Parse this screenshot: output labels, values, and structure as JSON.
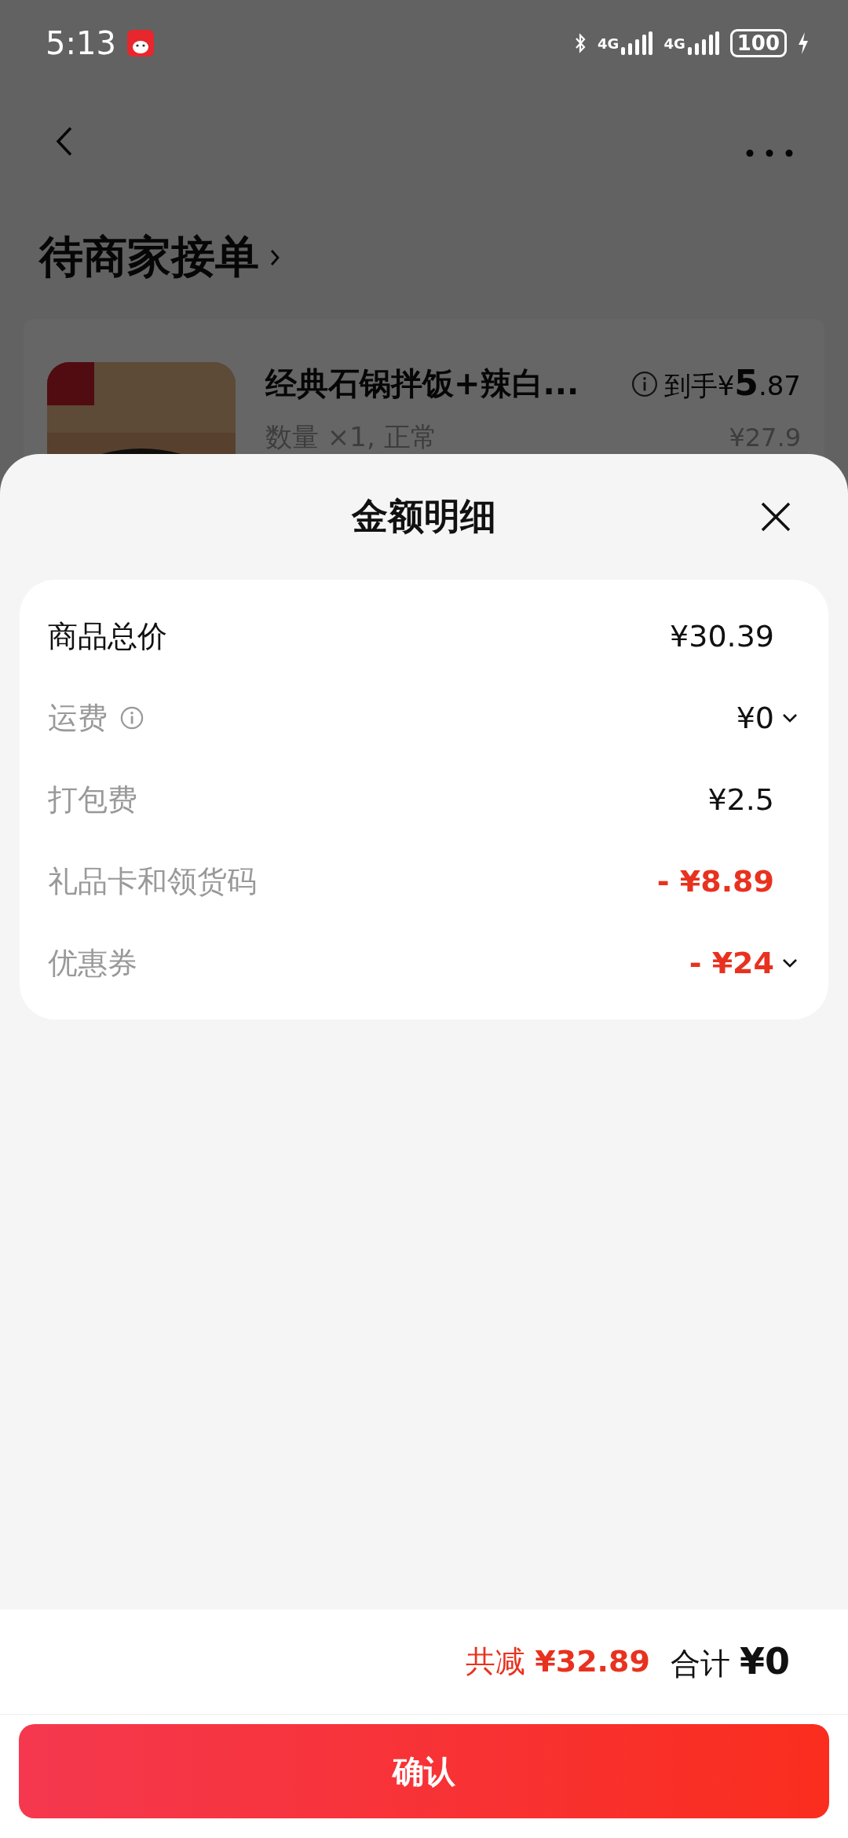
{
  "status_bar": {
    "time": "5:13",
    "networks": [
      "4G",
      "4G"
    ],
    "battery": "100"
  },
  "order": {
    "status_title": "待商家接单",
    "item": {
      "kind": "picture",
      "name": "经典石锅拌饭+辣白...",
      "quantity": "数量 ×1, 正常",
      "price_label": "到手",
      "price": {
        "symbol": "¥",
        "integer": "5",
        "decimal": ".87"
      },
      "original_price": "¥27.9"
    }
  },
  "sheet": {
    "title": "金额明细",
    "rows": [
      {
        "kind": "total",
        "label": "商品总价",
        "value": "¥30.39",
        "info": false,
        "expandable": false
      },
      {
        "kind": "fee",
        "label": "运费",
        "value": "¥0",
        "info": true,
        "expandable": true
      },
      {
        "kind": "fee",
        "label": "打包费",
        "value": "¥2.5",
        "info": false,
        "expandable": false
      },
      {
        "kind": "discount",
        "label": "礼品卡和领货码",
        "value": "- ¥8.89",
        "info": false,
        "expandable": false
      },
      {
        "kind": "discount",
        "label": "优惠券",
        "value": "- ¥24",
        "info": false,
        "expandable": true
      }
    ]
  },
  "summary": {
    "saved_label": "共减",
    "saved": "¥32.89",
    "total_label": "合计",
    "total": "¥0"
  },
  "confirm_button": "确认"
}
